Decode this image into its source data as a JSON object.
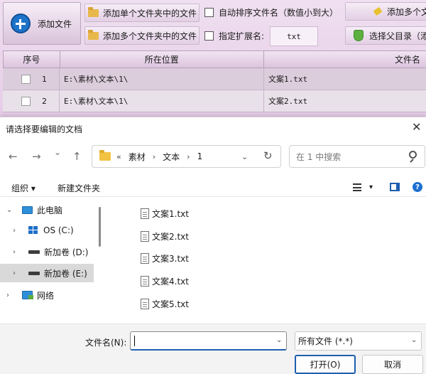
{
  "app": {
    "add_file_label": "添加文件",
    "add_single_folder": "添加单个文件夹中的文件",
    "add_multi_folder": "添加多个文件夹中的文件",
    "auto_sort_label": "自动排序文件名（数值小到大）",
    "ext_label": "指定扩展名:",
    "ext_value": "txt",
    "add_multi_right": "添加多个文",
    "choose_parent": "选择父目录（添",
    "columns": {
      "no": "序号",
      "location": "所在位置",
      "name": "文件名"
    },
    "rows": [
      {
        "no": "1",
        "location": "E:\\素材\\文本\\1\\",
        "name": "文案1.txt"
      },
      {
        "no": "2",
        "location": "E:\\素材\\文本\\1\\",
        "name": "文案2.txt"
      }
    ]
  },
  "dialog": {
    "title": "请选择要编辑的文档",
    "close": "✕",
    "back": "←",
    "forward": "→",
    "history": "⌄",
    "up": "↑",
    "address": {
      "more": "«",
      "seg1": "素材",
      "sep": "›",
      "seg2": "文本",
      "seg3": "1"
    },
    "refresh": "↻",
    "search_placeholder": "在 1 中搜索",
    "organize": "组织 ▾",
    "new_folder": "新建文件夹",
    "view_dropdown": "▾",
    "help": "?",
    "tree": [
      {
        "label": "此电脑",
        "chevron": "⌄",
        "icon": "pc-icon"
      },
      {
        "label": "OS (C:)",
        "chevron": "›",
        "icon": "os-drive-icon"
      },
      {
        "label": "新加卷 (D:)",
        "chevron": "›",
        "icon": "drive-icon"
      },
      {
        "label": "新加卷 (E:)",
        "chevron": "›",
        "icon": "drive-icon",
        "selected": true
      },
      {
        "label": "网络",
        "chevron": "›",
        "icon": "network-icon"
      }
    ],
    "files": [
      "文案1.txt",
      "文案2.txt",
      "文案3.txt",
      "文案4.txt",
      "文案5.txt"
    ],
    "filename_label": "文件名(N):",
    "filename_value": "",
    "filetype_value": "所有文件 (*.*)",
    "dropdown_glyph": "⌄",
    "open_button": "打开(O)",
    "cancel_button": "取消"
  }
}
